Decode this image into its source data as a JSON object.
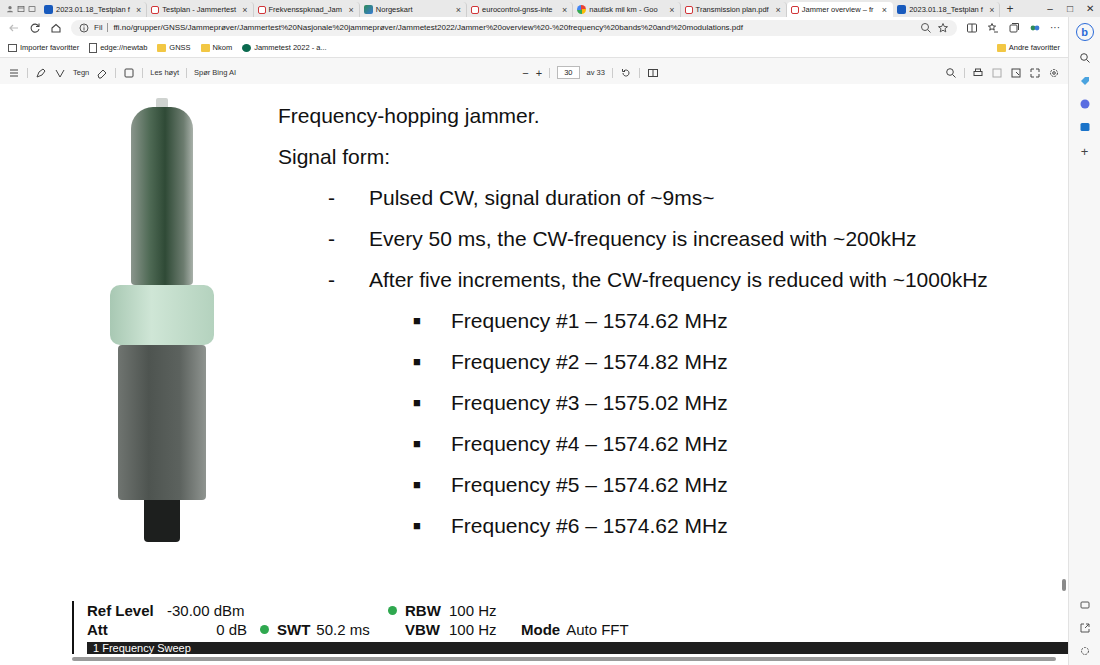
{
  "tabs": [
    {
      "label": "2023.01.18_Testplan f",
      "kind": "word",
      "selected": false
    },
    {
      "label": "Testplan - Jammertest",
      "kind": "pdf",
      "selected": false
    },
    {
      "label": "Frekvensspknad_Jam",
      "kind": "pdf",
      "selected": false
    },
    {
      "label": "Norgeskart",
      "kind": "map",
      "selected": false
    },
    {
      "label": "eurocontrol-gnss-inte",
      "kind": "pdf",
      "selected": false
    },
    {
      "label": "nautisk mil km - Goo",
      "kind": "google",
      "selected": false
    },
    {
      "label": "Transmission plan.pdf",
      "kind": "pdf",
      "selected": false
    },
    {
      "label": "Jammer overview – fr",
      "kind": "pdf",
      "selected": true
    },
    {
      "label": "2023.01.18_Testplan f",
      "kind": "word",
      "selected": false
    }
  ],
  "tab_close": "×",
  "new_tab": "+",
  "window_controls": [
    "–",
    "□",
    "✕"
  ],
  "address_bar": {
    "back_enabled": false,
    "scheme": "Fil",
    "url": "ffi.no/grupper/GNSS/Jammeprøver/Jammertest%20Nasjonale%20jammeprøver/Jammetest2022/Jammer%20overview%20-%20frequency%20bands%20and%20modulations.pdf",
    "more": "···"
  },
  "favorites": {
    "items": [
      {
        "label": "Importer favoritter",
        "kind": "import"
      },
      {
        "label": "edge://newtab",
        "kind": "page"
      },
      {
        "label": "GNSS",
        "kind": "folder"
      },
      {
        "label": "Nkom",
        "kind": "folder"
      },
      {
        "label": "Jammetest 2022 - a...",
        "kind": "site"
      }
    ],
    "other": "Andre favoritter"
  },
  "pdf_toolbar": {
    "draw": "Tegn",
    "read_aloud": "Les høyt",
    "ask_ai": "Spør Bing AI",
    "zoom_out": "−",
    "zoom_in": "+",
    "page": "30",
    "page_total": "av 33"
  },
  "slide": {
    "title": "Frequency-hopping jammer.",
    "subtitle": "Signal form:",
    "bullet_marker": "-",
    "bullets": [
      "Pulsed CW, signal duration of ~9ms~",
      "Every 50 ms, the CW-frequency is increased with ~200kHz",
      "After five increments, the CW-frequency is reduced with ~1000kHz"
    ],
    "sub_marker": "■",
    "frequencies": [
      "Frequency #1 – 1574.62 MHz",
      "Frequency #2 – 1574.82 MHz",
      "Frequency #3 – 1575.02 MHz",
      "Frequency #4 – 1574.62 MHz",
      "Frequency #5 – 1574.62 MHz",
      "Frequency #6 – 1574.62 MHz"
    ]
  },
  "analyzer": {
    "ref_level": {
      "label": "Ref Level",
      "value": "-30.00 dBm"
    },
    "att": {
      "label": "Att",
      "value": "0 dB"
    },
    "swt": {
      "label": "SWT",
      "value": "50.2 ms",
      "indicator": true
    },
    "rbw": {
      "label": "RBW",
      "value": "100 Hz",
      "indicator": true
    },
    "vbw": {
      "label": "VBW",
      "value": "100 Hz",
      "indicator": false
    },
    "mode": {
      "label": "Mode",
      "value": "Auto FFT"
    },
    "window": "1 Frequency Sweep"
  },
  "sidebar": {
    "bing": "b",
    "add": "+"
  },
  "scrollbars": {
    "vertical": {
      "level": 0.87
    },
    "horizontal": {
      "level": 0.93
    }
  }
}
